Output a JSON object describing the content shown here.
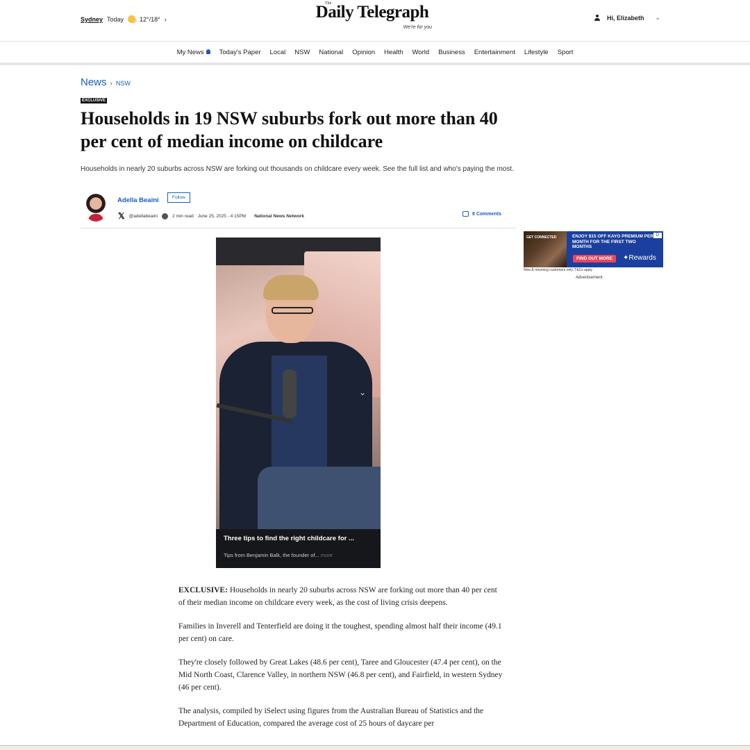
{
  "header": {
    "location": {
      "city": "Sydney",
      "today": "Today",
      "temp": "12°/18°"
    },
    "brand": {
      "the": "The",
      "name": "Daily Telegraph",
      "tagline": "We're for you"
    },
    "user": {
      "greeting": "Hi, Elizabeth"
    }
  },
  "nav": {
    "items": [
      "My News",
      "Today's Paper",
      "Local",
      "NSW",
      "National",
      "Opinion",
      "Health",
      "World",
      "Business",
      "Entertainment",
      "Lifestyle",
      "Sport"
    ]
  },
  "breadcrumb": {
    "section": "News",
    "subsection": "NSW"
  },
  "article": {
    "tag": "EXCLUSIVE",
    "headline": "Households in 19 NSW suburbs fork out more than 40 per cent of median income on childcare",
    "standfirst": "Households in nearly 20 suburbs across NSW are forking out thousands on childcare every week. See the full list and who's paying the most.",
    "author": "Adella Beaini",
    "follow_label": "Follow",
    "handle": "@adellabeaini",
    "read_time": "2 min read",
    "date": "June 25, 2025 - 4:15PM",
    "network": "National News Network",
    "comments": "8 Comments"
  },
  "video": {
    "title": "Three tips to find the right childcare for ...",
    "subtitle": "Tips from Benjamin Balk, the founder of...",
    "more": "more"
  },
  "ad": {
    "image_text": "GET CONNECTED",
    "headline": "ENJOY $15 OFF KAYO PREMIUM PER MONTH FOR THE FIRST TWO MONTHS",
    "cta": "FIND OUT MORE",
    "rewards": "Rewards",
    "flag": "D",
    "note": "New & returning customers only. T&Cs apply",
    "label": "Advertisement"
  },
  "body": {
    "p1_lead": "EXCLUSIVE:",
    "p1": " Households in nearly 20 suburbs across NSW are forking out more than 40 per cent of their median income on childcare every week, as the cost of living crisis deepens.",
    "p2": "Families in Inverell and Tenterfield are doing it the toughest, spending almost half their income (49.1 per cent) on care.",
    "p3": "They're closely followed by Great Lakes (48.6 per cent), Taree and Gloucester (47.4 per cent), on the Mid North Coast, Clarence Valley, in northern NSW (46.8 per cent), and Fairfield, in western Sydney (46 per cent).",
    "p4": "The analysis, compiled by iSelect using figures from the Australian Bureau of Statistics and the Department of Education, compared the average cost of 25 hours of daycare per"
  },
  "colors": {
    "link_blue": "#1a5bbf",
    "ad_blue": "#1a3f9e",
    "ad_pink": "#e8465e"
  }
}
